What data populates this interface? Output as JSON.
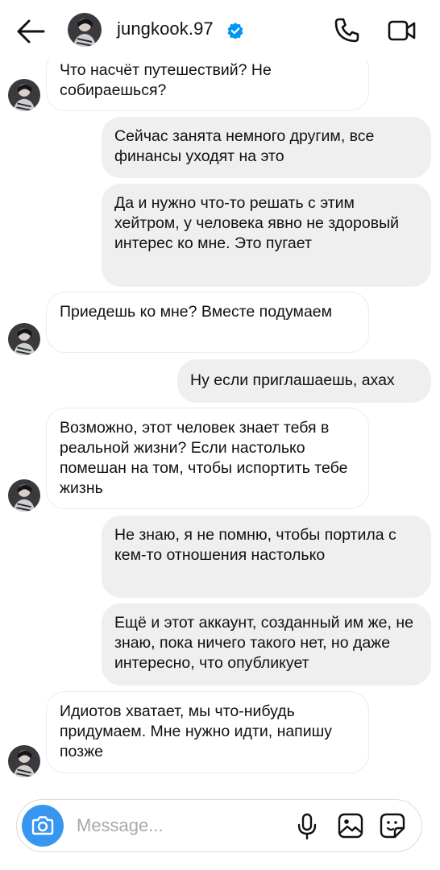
{
  "header": {
    "username": "jungkook.97",
    "verified": true,
    "back_icon": "arrow-left-icon",
    "call_icon": "phone-icon",
    "video_icon": "video-camera-icon"
  },
  "messages": [
    {
      "from": "them",
      "text": "Что насчёт путешествий? Не собираешься?"
    },
    {
      "from": "me",
      "text": "Сейчас занята немного другим, все финансы уходят на это"
    },
    {
      "from": "me",
      "text": "Да и нужно что-то решать с этим хейтром, у человека явно не здоровый интерес ко мне. Это пугает"
    },
    {
      "from": "them",
      "text": "Приедешь ко мне? Вместе подумаем"
    },
    {
      "from": "me",
      "text": "Ну если приглашаешь, ахах"
    },
    {
      "from": "them",
      "text": "Возможно, этот человек знает тебя в реальной жизни? Если настолько помешан на том, чтобы испортить тебе жизнь"
    },
    {
      "from": "me",
      "text": "Не знаю, я не помню, чтобы портила с кем-то отношения настолько"
    },
    {
      "from": "me",
      "text": "Ещё и этот аккаунт, созданный им же, не знаю, пока ничего такого нет, но даже интересно, что опубликует"
    },
    {
      "from": "them",
      "text": "Идиотов хватает, мы что-нибудь придумаем. Мне нужно идти, напишу позже"
    }
  ],
  "composer": {
    "placeholder": "Message...",
    "value": "",
    "icons": [
      "camera-icon",
      "microphone-icon",
      "gallery-icon",
      "sticker-icon"
    ]
  },
  "colors": {
    "accent": "#3797f0",
    "verified": "#0095f6",
    "outgoing_bubble": "#efefef",
    "incoming_border": "#ececec"
  }
}
